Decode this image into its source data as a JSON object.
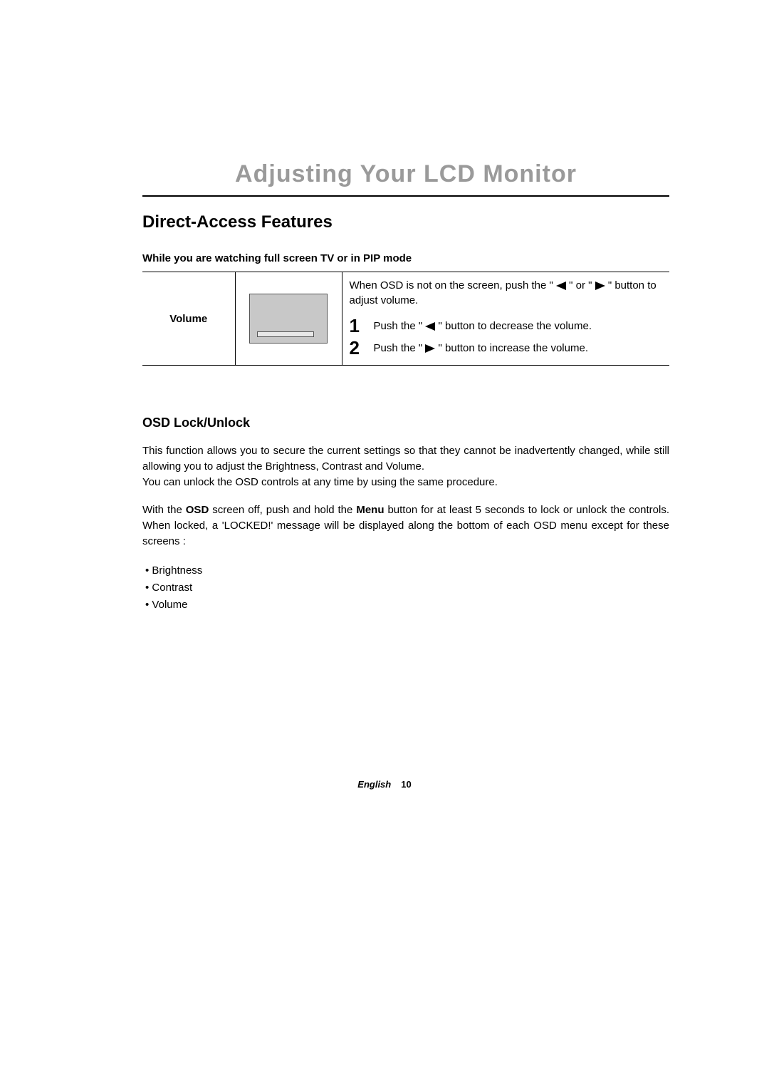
{
  "chapter_title": "Adjusting Your LCD Monitor",
  "section_title": "Direct-Access Features",
  "subsection_intro": "While you are watching full screen TV or in PIP mode",
  "table": {
    "row_label": "Volume",
    "intro_a": "When OSD is not on the screen, push the \" ",
    "intro_b": " \" or \" ",
    "intro_c": " \" button to adjust volume.",
    "step1_num": "1",
    "step1_a": "Push the \" ",
    "step1_b": " \" button to decrease the volume.",
    "step2_num": "2",
    "step2_a": "Push the \" ",
    "step2_b": " \" button to increase the volume."
  },
  "osd": {
    "heading": "OSD Lock/Unlock",
    "para1": "This function allows you to secure the current settings so that they cannot be inadvertently changed, while still allowing you to adjust the Brightness, Contrast and Volume.\nYou can unlock the OSD controls at any time by using the same procedure.",
    "para2_a": "With the ",
    "para2_osd": "OSD",
    "para2_b": " screen off, push and hold the ",
    "para2_menu": "Menu",
    "para2_c": " button for at least 5 seconds to lock or unlock the controls. When locked, a 'LOCKED!' message will be displayed along the bottom of each OSD menu except for these screens :",
    "bullets": [
      "Brightness",
      "Contrast",
      "Volume"
    ]
  },
  "footer": {
    "language": "English",
    "page": "10"
  }
}
